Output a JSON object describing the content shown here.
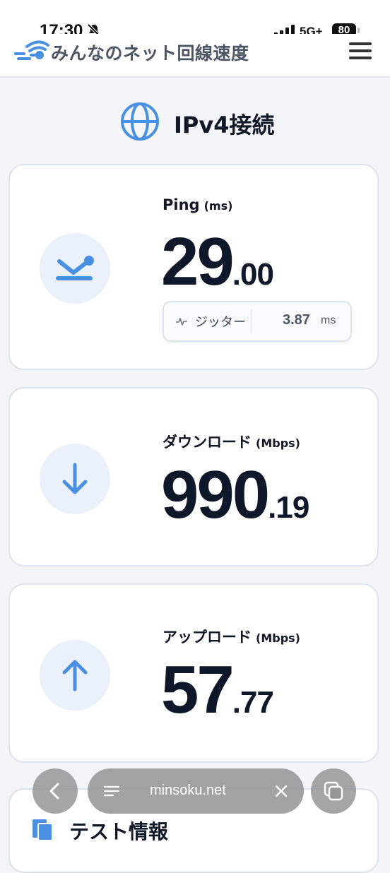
{
  "status_bar": {
    "time": "17:30",
    "network": "5G+",
    "battery": "80"
  },
  "header": {
    "site_title": "みんなのネット回線速度"
  },
  "section": {
    "title": "IPv4接続"
  },
  "ping": {
    "label": "Ping",
    "unit": "(ms)",
    "value_int": "29",
    "value_dec": ".00",
    "jitter_label": "ジッター",
    "jitter_value": "3.87",
    "jitter_unit": "ms"
  },
  "download": {
    "label": "ダウンロード",
    "unit": "(Mbps)",
    "value_int": "990",
    "value_dec": ".19"
  },
  "upload": {
    "label": "アップロード",
    "unit": "(Mbps)",
    "value_int": "57",
    "value_dec": ".77"
  },
  "info_card": {
    "title": "テスト情報"
  },
  "browser": {
    "url": "minsoku.net"
  },
  "icons": {
    "bell": "bell-slash-icon",
    "signal": "signal-bars-icon",
    "logo": "wifi-logo-icon",
    "menu": "hamburger-menu-icon",
    "globe": "globe-icon",
    "ping": "ping-arrow-icon",
    "download": "arrow-down-icon",
    "upload": "arrow-up-icon",
    "jitter": "pulse-icon",
    "info": "document-icon",
    "back": "chevron-left-icon",
    "reader": "reader-lines-icon",
    "close": "close-icon",
    "tabs": "tabs-icon"
  },
  "colors": {
    "accent": "#4a90e2",
    "icon_bg": "#eaf1fb",
    "value_text": "#0f172a",
    "card_border": "#dde3ea"
  }
}
